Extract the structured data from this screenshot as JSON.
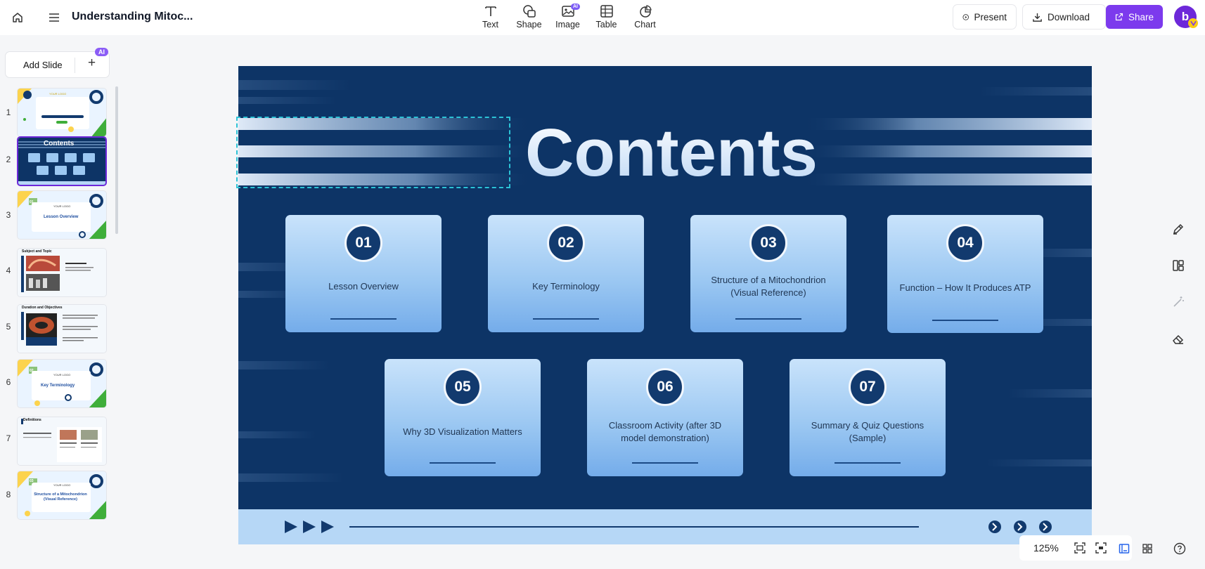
{
  "app": {
    "doc_title": "Understanding Mitoc..."
  },
  "toolbar": {
    "tools": [
      {
        "label": "Text",
        "icon": "text-icon"
      },
      {
        "label": "Shape",
        "icon": "shape-icon"
      },
      {
        "label": "Image",
        "icon": "image-icon",
        "badge": "AI"
      },
      {
        "label": "Table",
        "icon": "table-icon"
      },
      {
        "label": "Chart",
        "icon": "chart-icon"
      }
    ],
    "present_label": "Present",
    "download_label": "Download",
    "share_label": "Share",
    "avatar_letter": "b"
  },
  "sidebar": {
    "add_slide_label": "Add Slide",
    "add_slide_plus": "+",
    "ai_badge": "AI",
    "selected_slide": 2,
    "slides": [
      {
        "num": "1",
        "texts": [
          "YOUR LOGO"
        ]
      },
      {
        "num": "2",
        "texts": [
          "Contents"
        ]
      },
      {
        "num": "3",
        "texts": [
          "01",
          "YOUR LOGO",
          "Lesson Overview"
        ]
      },
      {
        "num": "4",
        "texts": [
          "Subject and Topic"
        ]
      },
      {
        "num": "5",
        "texts": [
          "Duration and Objectives"
        ]
      },
      {
        "num": "6",
        "texts": [
          "02",
          "YOUR LOGO",
          "Key Terminology"
        ]
      },
      {
        "num": "7",
        "texts": [
          "Definitions"
        ]
      },
      {
        "num": "8",
        "texts": [
          "03",
          "YOUR LOGO",
          "Structure of a Mitochondrion (Visual Reference)"
        ]
      }
    ]
  },
  "slide": {
    "title": "Contents",
    "items": [
      {
        "num": "01",
        "text": "Lesson Overview"
      },
      {
        "num": "02",
        "text": "Key Terminology"
      },
      {
        "num": "03",
        "text": "Structure of a Mitochondrion (Visual Reference)"
      },
      {
        "num": "04",
        "text": "Function – How It Produces ATP"
      },
      {
        "num": "05",
        "text": "Why 3D Visualization Matters"
      },
      {
        "num": "06",
        "text": "Classroom Activity (after 3D model demonstration)"
      },
      {
        "num": "07",
        "text": "Summary & Quiz Questions (Sample)"
      }
    ]
  },
  "zoom": {
    "level": "125%"
  },
  "colors": {
    "accent": "#7c3aed",
    "slide_bg": "#0d3466",
    "card_number_bg": "#123a6e",
    "selection_outline": "#2cc2d6"
  }
}
